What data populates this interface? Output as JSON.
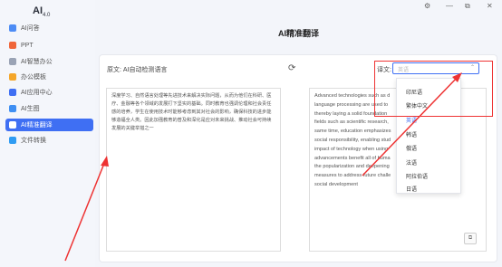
{
  "app": {
    "name": "AI",
    "version": "4.0"
  },
  "window_controls": [
    "⚙",
    "—",
    "⧉",
    "✕"
  ],
  "sidebar": {
    "items": [
      {
        "label": "AI问答",
        "color": "#4d8cf5"
      },
      {
        "label": "PPT",
        "color": "#f0663a"
      },
      {
        "label": "AI智慧办公",
        "color": "#9aa3b5"
      },
      {
        "label": "办公模板",
        "color": "#f4a62a"
      },
      {
        "label": "AI应用中心",
        "color": "#3f6ff3"
      },
      {
        "label": "AI生图",
        "color": "#3f8ff3"
      },
      {
        "label": "AI精准翻译",
        "color": "#f6b33c",
        "active": true
      },
      {
        "label": "文件转换",
        "color": "#2f9cf3"
      }
    ]
  },
  "page": {
    "title": "AI精准翻译",
    "source_label": "原文: AI自动检测语言",
    "target_label": "译文:",
    "target_placeholder": "英语",
    "source_text": "深度学习、自然语言处理等先进技术来解决实际问题，从而为他们在科研、医疗、金融等各个领域的发展打下坚实的基础。同时教育也强调伦理和社会责任感的培养，学生在使用技术时能够考虑到其对社会的影响，确保科技的进步能够造福全人类。因此加强教育的普及和深化是应对未来挑战、推动社会可持续发展的关键举措之一",
    "target_lines": [
      "Advanced technologies such as d",
      "language processing are used to",
      "thereby laying a solid foundation",
      "fields such as scientific research,",
      "same time, education emphasizes",
      "social responsibility, enabling stud",
      "impact of technology when using",
      "advancements benefit all of huma",
      "the popularization and deepening",
      "measures to address future challe",
      "social development"
    ],
    "language_options": [
      "印尼语",
      "繁体中文",
      "英语",
      "韩语",
      "俄语",
      "法语",
      "阿拉伯语",
      "日语"
    ],
    "highlighted_option": "英语"
  }
}
